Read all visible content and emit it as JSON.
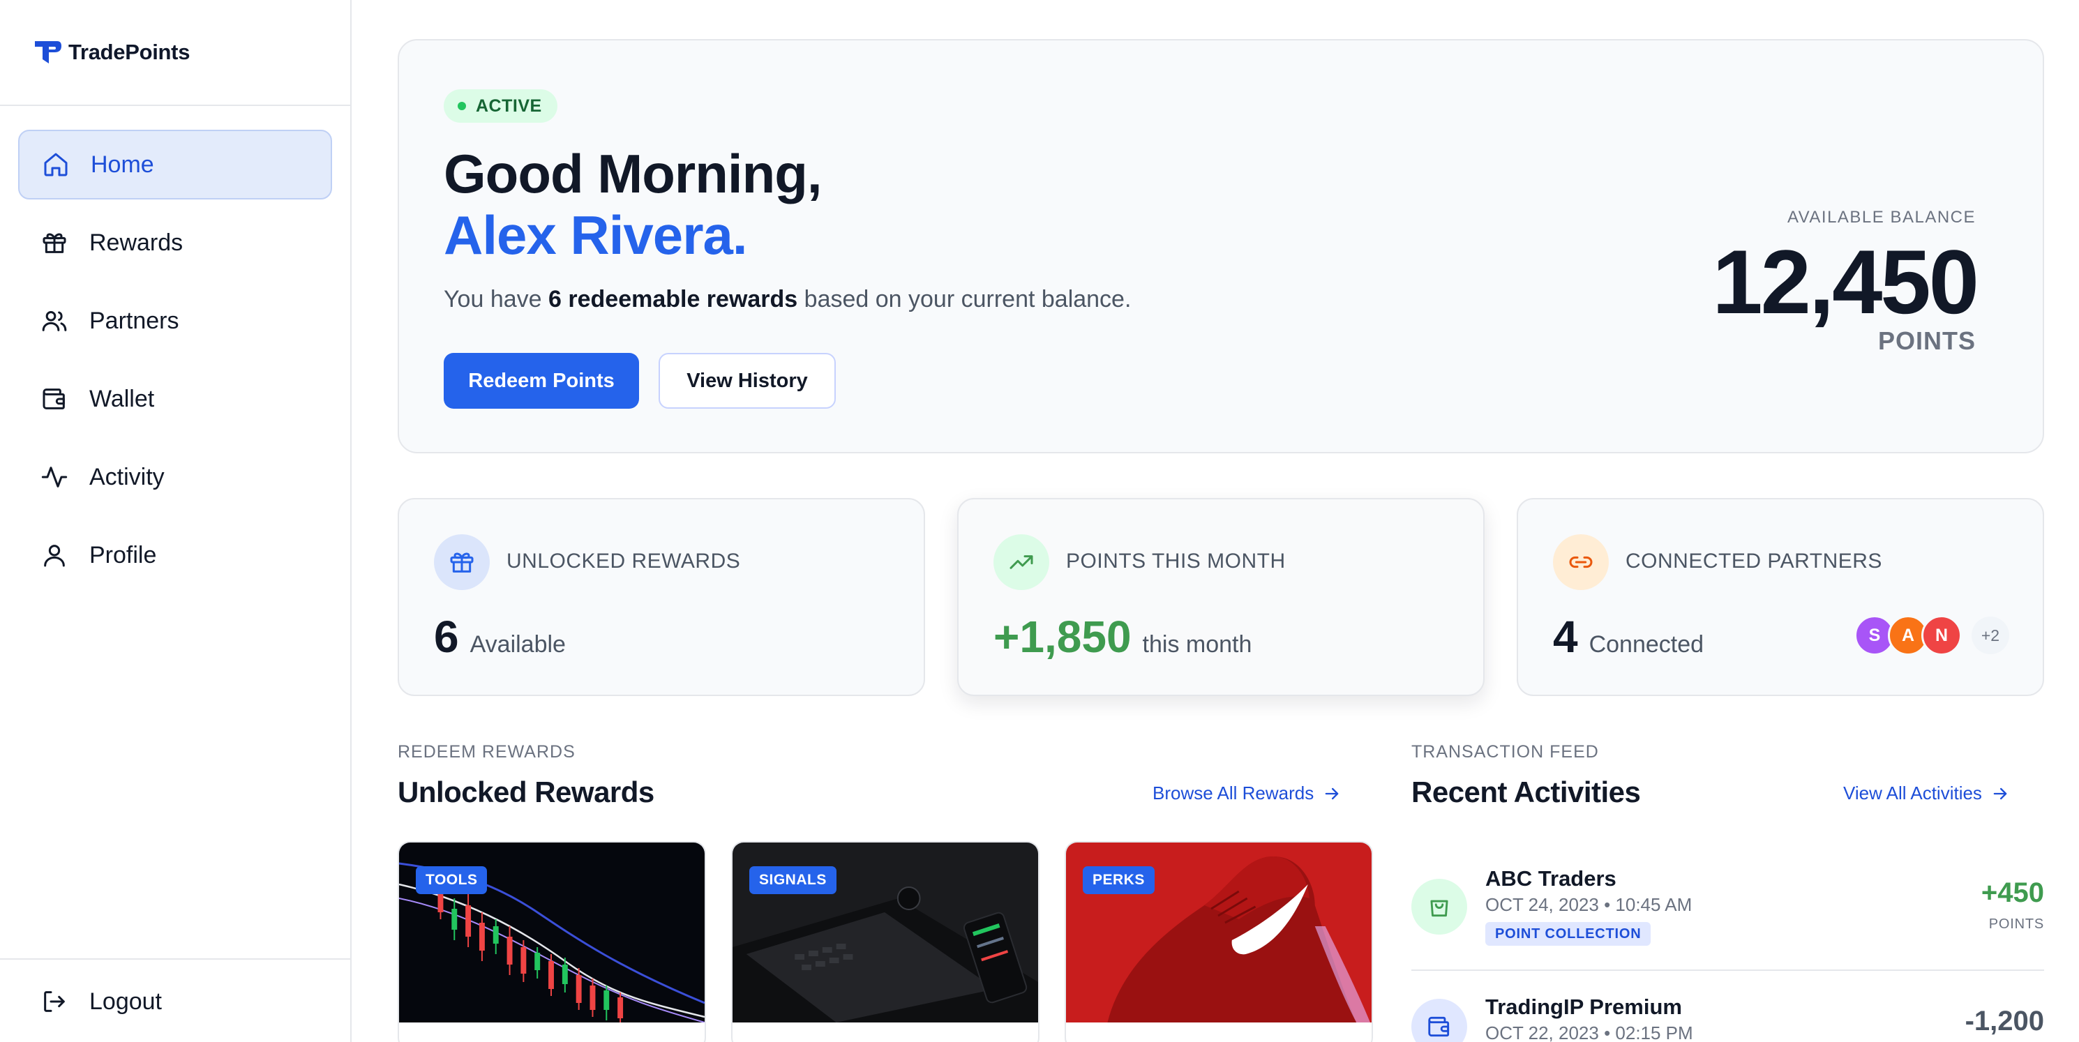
{
  "brand": {
    "name": "TradePoints",
    "accent": "#2563eb"
  },
  "sidebar": {
    "items": [
      {
        "label": "Home",
        "icon": "home-icon",
        "active": true
      },
      {
        "label": "Rewards",
        "icon": "gift-icon"
      },
      {
        "label": "Partners",
        "icon": "users-icon"
      },
      {
        "label": "Wallet",
        "icon": "wallet-icon"
      },
      {
        "label": "Activity",
        "icon": "activity-icon"
      },
      {
        "label": "Profile",
        "icon": "user-icon"
      }
    ],
    "logout_label": "Logout"
  },
  "hero": {
    "status": "ACTIVE",
    "greeting": "Good Morning,",
    "user_name": "Alex Rivera.",
    "sub_prefix": "You have",
    "sub_bold": "6 redeemable rewards",
    "sub_suffix": "based on your current balance.",
    "primary_button": "Redeem Points",
    "secondary_button": "View History",
    "balance_label": "AVAILABLE BALANCE",
    "balance_value": "12,450",
    "balance_unit": "POINTS"
  },
  "stats": [
    {
      "label": "UNLOCKED REWARDS",
      "value": "6",
      "unit": "Available",
      "icon": "gift-icon",
      "color": "#2563eb"
    },
    {
      "label": "POINTS THIS MONTH",
      "value": "+1,850",
      "unit": "this month",
      "icon": "trending-up-icon",
      "color": "#3f9b4f"
    },
    {
      "label": "CONNECTED PARTNERS",
      "value": "4",
      "unit": "Connected",
      "icon": "link-icon",
      "color": "#ea580c",
      "avatars": [
        {
          "letter": "S",
          "color": "#a855f7"
        },
        {
          "letter": "A",
          "color": "#f97316"
        },
        {
          "letter": "N",
          "color": "#ef4444"
        }
      ],
      "more": "+2"
    }
  ],
  "rewards_section": {
    "eyebrow": "REDEEM REWARDS",
    "title": "Unlocked Rewards",
    "link": "Browse All Rewards",
    "cards": [
      {
        "tag": "TOOLS"
      },
      {
        "tag": "SIGNALS"
      },
      {
        "tag": "PERKS"
      }
    ]
  },
  "activity_section": {
    "eyebrow": "TRANSACTION FEED",
    "title": "Recent Activities",
    "link": "View All Activities",
    "items": [
      {
        "name": "ABC Traders",
        "date": "OCT 24, 2023 • 10:45 AM",
        "tag": "POINT COLLECTION",
        "amount": "+450",
        "unit": "POINTS",
        "icon": "shopping-bag-icon"
      },
      {
        "name": "TradingIP Premium",
        "date": "OCT 22, 2023 • 02:15 PM",
        "amount": "-1,200",
        "icon": "wallet-icon"
      }
    ]
  }
}
